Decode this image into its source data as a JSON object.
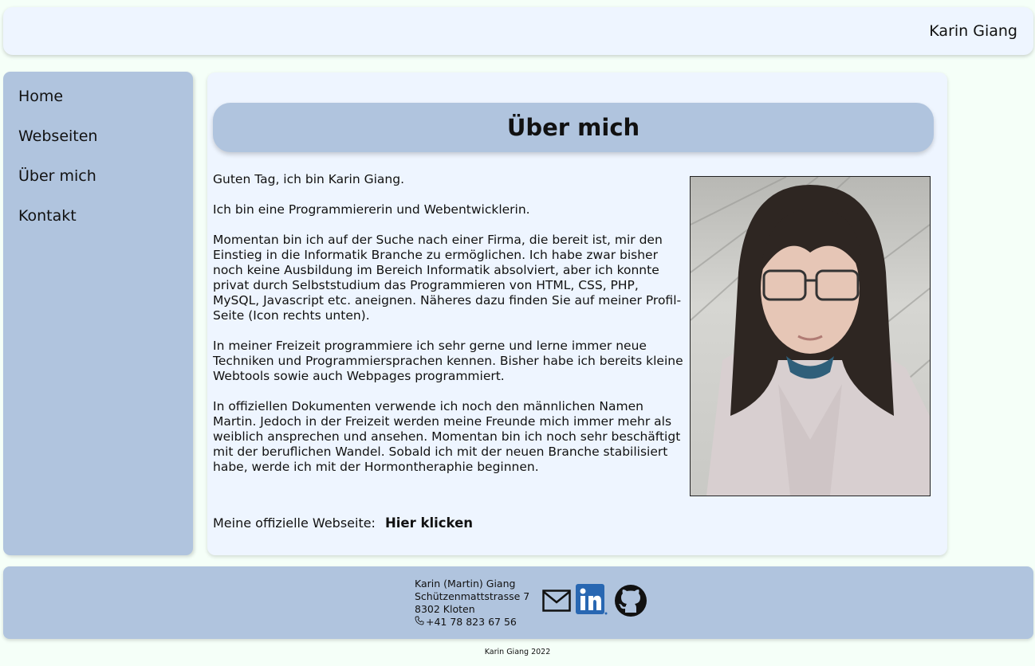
{
  "header": {
    "name": "Karin Giang"
  },
  "sidebar": {
    "items": [
      {
        "label": "Home"
      },
      {
        "label": "Webseiten"
      },
      {
        "label": "Über mich"
      },
      {
        "label": "Kontakt"
      }
    ]
  },
  "main": {
    "title": "Über mich",
    "paragraphs": [
      "Guten Tag, ich bin Karin Giang.",
      "Ich bin eine Programmiererin und Webentwicklerin.",
      "Momentan bin ich auf der Suche nach einer Firma, die bereit ist, mir den Einstieg in die Informatik Branche zu ermöglichen. Ich habe zwar bisher noch keine Ausbildung im Bereich Informatik absolviert, aber ich konnte privat durch Selbststudium das Programmieren von HTML, CSS, PHP, MySQL, Javascript etc. aneignen. Näheres dazu finden Sie auf meiner Profil-Seite (Icon rechts unten).",
      "In meiner Freizeit programmiere ich sehr gerne und lerne immer neue Techniken und Programmiersprachen kennen. Bisher habe ich bereits kleine Webtools sowie auch Webpages programmiert.",
      "In offiziellen Dokumenten verwende ich noch den männlichen Namen Martin. Jedoch in der Freizeit werden meine Freunde mich immer mehr als weiblich ansprechen und ansehen. Momentan bin ich noch sehr beschäftigt mit der beruflichen Wandel. Sobald ich mit der neuen Branche stabilisiert habe, werde ich mit der Hormontheraphie beginnen."
    ],
    "website_label": "Meine offizielle Webseite:",
    "website_link": "Hier klicken"
  },
  "footer": {
    "name": "Karin (Martin) Giang",
    "street": "Schützenmattstrasse 7",
    "city": "8302 Kloten",
    "phone": "+41 78 823 67 56",
    "icons": [
      "mail-icon",
      "linkedin-icon",
      "github-icon"
    ],
    "copyright": "Karin Giang 2022"
  },
  "colors": {
    "background": "#f5fff8",
    "panel": "#eef5ff",
    "accent": "#b0c4de",
    "linkedin": "#2867b2"
  }
}
